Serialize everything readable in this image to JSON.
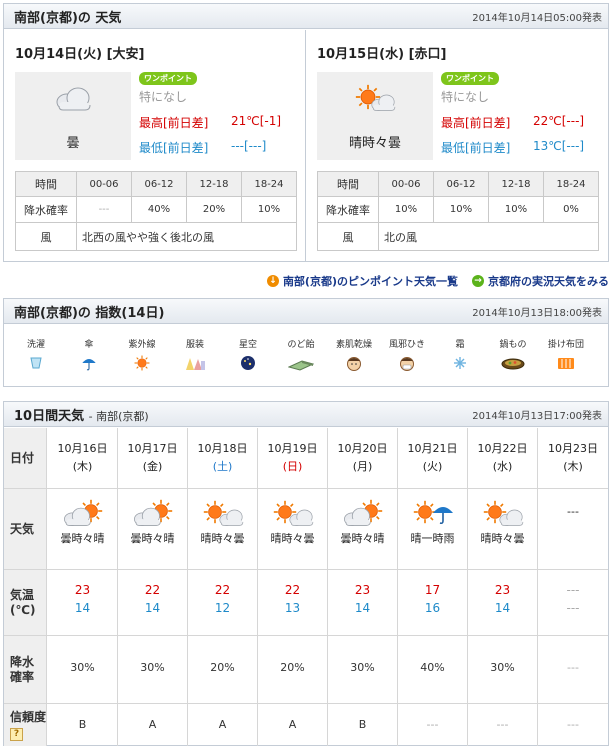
{
  "today_section": {
    "title": "南部(京都)の 天気",
    "issued": "2014年10月14日05:00発表",
    "days": [
      {
        "date": "10月14日(火) [大安]",
        "weather_icon": "cloudy-icon",
        "weather": "曇",
        "onepoint_badge": "ワンポイント",
        "onepoint_text": "特になし",
        "high_label": "最高[前日差]",
        "high_value": "21℃[-1]",
        "low_label": "最低[前日差]",
        "low_value": "---[---]",
        "precip_header": [
          "時間",
          "00-06",
          "06-12",
          "12-18",
          "18-24"
        ],
        "precip_label": "降水確率",
        "precip_values": [
          "---",
          "40%",
          "20%",
          "10%"
        ],
        "wind_label": "風",
        "wind_text": "北西の風やや強く後北の風"
      },
      {
        "date": "10月15日(水) [赤口]",
        "weather_icon": "sunny-cloudy-icon",
        "weather": "晴時々曇",
        "onepoint_badge": "ワンポイント",
        "onepoint_text": "特になし",
        "high_label": "最高[前日差]",
        "high_value": "22℃[---]",
        "low_label": "最低[前日差]",
        "low_value": "13℃[---]",
        "precip_header": [
          "時間",
          "00-06",
          "06-12",
          "12-18",
          "18-24"
        ],
        "precip_label": "降水確率",
        "precip_values": [
          "10%",
          "10%",
          "10%",
          "0%"
        ],
        "wind_label": "風",
        "wind_text": "北の風"
      }
    ]
  },
  "links": {
    "pinpoint": "南部(京都)のピンポイント天気一覧",
    "actual": "京都府の実況天気をみる"
  },
  "index_section": {
    "title": "南部(京都)の 指数(14日)",
    "issued": "2014年10月13日18:00発表",
    "items": [
      {
        "label": "洗濯",
        "icon": "laundry-icon"
      },
      {
        "label": "傘",
        "icon": "umbrella-icon"
      },
      {
        "label": "紫外線",
        "icon": "uv-sun-icon"
      },
      {
        "label": "服装",
        "icon": "clothing-icon"
      },
      {
        "label": "星空",
        "icon": "starry-sky-icon"
      },
      {
        "label": "のど飴",
        "icon": "throat-candy-icon"
      },
      {
        "label": "素肌乾燥",
        "icon": "dry-skin-icon"
      },
      {
        "label": "風邪ひき",
        "icon": "cold-face-icon"
      },
      {
        "label": "霜",
        "icon": "frost-icon"
      },
      {
        "label": "鍋もの",
        "icon": "hotpot-icon"
      },
      {
        "label": "掛け布団",
        "icon": "futon-icon"
      }
    ]
  },
  "ten_day_section": {
    "title": "10日間天気",
    "subtitle": "- 南部(京都)",
    "issued": "2014年10月13日17:00発表",
    "row_labels": {
      "date": "日付",
      "weather": "天気",
      "temp_1": "気温",
      "temp_2": "(℃)",
      "precip_1": "降水",
      "precip_2": "確率",
      "reliability": "信頼度",
      "help": "?"
    },
    "days": [
      {
        "date": "10月16日",
        "dow": "(木)",
        "dow_type": "weekday",
        "icon": "cloudy-sunny-icon",
        "weather": "曇時々晴",
        "high": "23",
        "low": "14",
        "precip": "30%",
        "reliability": "B"
      },
      {
        "date": "10月17日",
        "dow": "(金)",
        "dow_type": "weekday",
        "icon": "cloudy-sunny-icon",
        "weather": "曇時々晴",
        "high": "22",
        "low": "14",
        "precip": "30%",
        "reliability": "A"
      },
      {
        "date": "10月18日",
        "dow": "(土)",
        "dow_type": "sat",
        "icon": "sunny-cloudy-icon",
        "weather": "晴時々曇",
        "high": "22",
        "low": "12",
        "precip": "20%",
        "reliability": "A"
      },
      {
        "date": "10月19日",
        "dow": "(日)",
        "dow_type": "sun",
        "icon": "sunny-cloudy-icon",
        "weather": "晴時々曇",
        "high": "22",
        "low": "13",
        "precip": "20%",
        "reliability": "A"
      },
      {
        "date": "10月20日",
        "dow": "(月)",
        "dow_type": "weekday",
        "icon": "cloudy-sunny-icon",
        "weather": "曇時々晴",
        "high": "23",
        "low": "14",
        "precip": "30%",
        "reliability": "B"
      },
      {
        "date": "10月21日",
        "dow": "(火)",
        "dow_type": "weekday",
        "icon": "sunny-rain-icon",
        "weather": "晴一時雨",
        "high": "17",
        "low": "16",
        "precip": "40%",
        "reliability": "---"
      },
      {
        "date": "10月22日",
        "dow": "(水)",
        "dow_type": "weekday",
        "icon": "sunny-cloudy-icon",
        "weather": "晴時々曇",
        "high": "23",
        "low": "14",
        "precip": "30%",
        "reliability": "---"
      },
      {
        "date": "10月23日",
        "dow": "(木)",
        "dow_type": "weekday",
        "icon": "",
        "weather": "---",
        "high": "---",
        "low": "---",
        "precip": "---",
        "reliability": "---"
      }
    ]
  }
}
